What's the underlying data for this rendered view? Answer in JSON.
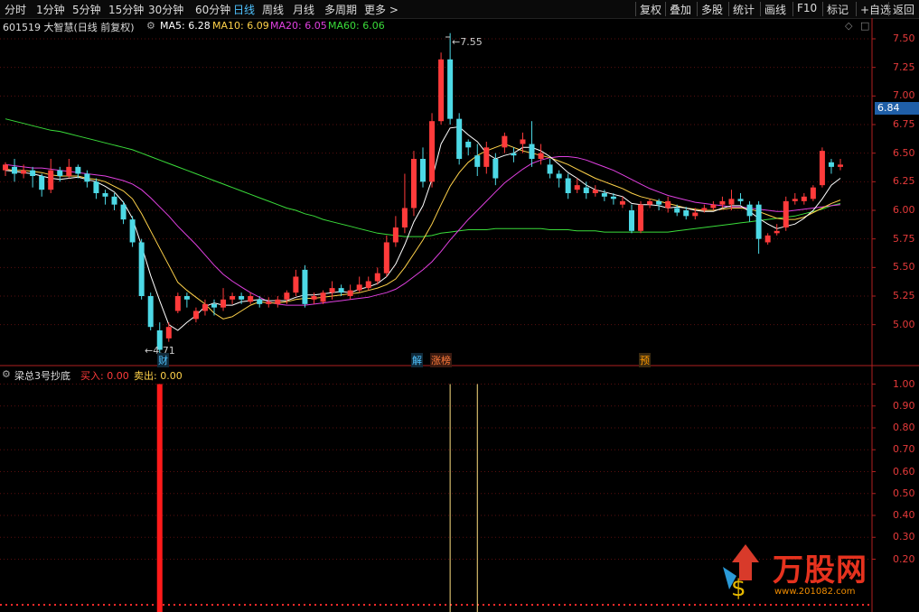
{
  "toolbar": {
    "periods": [
      "分时",
      "1分钟",
      "5分钟",
      "15分钟",
      "30分钟",
      "60分钟",
      "日线",
      "周线",
      "月线",
      "多周期",
      "更多 >"
    ],
    "active_period": "日线",
    "right_buttons": [
      "复权",
      "叠加",
      "多股",
      "统计",
      "画线",
      "F10",
      "标记",
      "+自选",
      "返回"
    ]
  },
  "stock": {
    "code_name": "601519 大智慧(日线 前复权)"
  },
  "ma": [
    {
      "label": "MA5: 6.28",
      "color": "#ffffff"
    },
    {
      "label": "MA10: 6.09",
      "color": "#ffd24a"
    },
    {
      "label": "MA20: 6.05",
      "color": "#e040e0"
    },
    {
      "label": "MA60: 6.06",
      "color": "#3adc3a"
    }
  ],
  "colors": {
    "up": "#ff3b3b",
    "down": "#4dd9e6",
    "axis": "#b02020",
    "grid": "#5a0f0f"
  },
  "price_axis": {
    "ticks": [
      "7.50",
      "7.25",
      "7.00",
      "6.75",
      "6.50",
      "6.25",
      "6.00",
      "5.75",
      "5.50",
      "5.25",
      "5.00"
    ],
    "current": "6.84"
  },
  "annotations": {
    "high": "7.55",
    "low": "4.71"
  },
  "events": [
    {
      "text": "财",
      "color": "#4fc3ff"
    },
    {
      "text": "解",
      "color": "#4fc3ff"
    },
    {
      "text": "涨榜",
      "color": "#ff7a3a"
    },
    {
      "text": "预",
      "color": "#ff9a00"
    }
  ],
  "indicator": {
    "name": "梁总3号抄底",
    "buy_label": "买入: 0.00",
    "sell_label": "卖出: 0.00",
    "axis_ticks": [
      "1.00",
      "0.90",
      "0.80",
      "0.70",
      "0.60",
      "0.50",
      "0.40",
      "0.30",
      "0.20"
    ]
  },
  "watermark": {
    "text": "万股网",
    "url": "www.201082.com"
  },
  "chart_data": {
    "type": "candlestick",
    "ylim": [
      4.65,
      7.65
    ],
    "candles": [
      [
        6.35,
        6.4,
        6.3,
        6.42
      ],
      [
        6.38,
        6.32,
        6.25,
        6.45
      ],
      [
        6.32,
        6.35,
        6.28,
        6.4
      ],
      [
        6.35,
        6.3,
        6.2,
        6.38
      ],
      [
        6.3,
        6.18,
        6.12,
        6.32
      ],
      [
        6.18,
        6.35,
        6.15,
        6.45
      ],
      [
        6.35,
        6.3,
        6.25,
        6.38
      ],
      [
        6.3,
        6.38,
        6.28,
        6.45
      ],
      [
        6.38,
        6.32,
        6.28,
        6.4
      ],
      [
        6.32,
        6.25,
        6.2,
        6.35
      ],
      [
        6.25,
        6.15,
        6.1,
        6.28
      ],
      [
        6.15,
        6.12,
        6.05,
        6.18
      ],
      [
        6.12,
        6.05,
        6.0,
        6.15
      ],
      [
        6.05,
        5.92,
        5.88,
        6.08
      ],
      [
        5.92,
        5.72,
        5.68,
        5.95
      ],
      [
        5.72,
        5.25,
        5.22,
        5.75
      ],
      [
        5.25,
        4.98,
        4.95,
        5.28
      ],
      [
        4.95,
        4.78,
        4.71,
        5.02
      ],
      [
        4.88,
        4.98,
        4.85,
        5.02
      ],
      [
        5.12,
        5.25,
        5.1,
        5.28
      ],
      [
        5.25,
        5.22,
        5.15,
        5.28
      ],
      [
        5.05,
        5.12,
        5.02,
        5.15
      ],
      [
        5.12,
        5.18,
        5.08,
        5.22
      ],
      [
        5.18,
        5.15,
        5.08,
        5.22
      ],
      [
        5.15,
        5.22,
        5.12,
        5.32
      ],
      [
        5.22,
        5.25,
        5.18,
        5.28
      ],
      [
        5.25,
        5.22,
        5.18,
        5.28
      ],
      [
        5.2,
        5.25,
        5.18,
        5.28
      ],
      [
        5.22,
        5.18,
        5.15,
        5.25
      ],
      [
        5.18,
        5.2,
        5.15,
        5.24
      ],
      [
        5.18,
        5.22,
        5.15,
        5.25
      ],
      [
        5.22,
        5.28,
        5.18,
        5.3
      ],
      [
        5.28,
        5.42,
        5.25,
        5.48
      ],
      [
        5.48,
        5.18,
        5.15,
        5.52
      ],
      [
        5.22,
        5.25,
        5.18,
        5.28
      ],
      [
        5.2,
        5.28,
        5.18,
        5.3
      ],
      [
        5.28,
        5.32,
        5.22,
        5.38
      ],
      [
        5.32,
        5.28,
        5.25,
        5.35
      ],
      [
        5.25,
        5.3,
        5.22,
        5.35
      ],
      [
        5.3,
        5.35,
        5.28,
        5.42
      ],
      [
        5.32,
        5.38,
        5.3,
        5.42
      ],
      [
        5.38,
        5.45,
        5.35,
        5.5
      ],
      [
        5.45,
        5.72,
        5.42,
        5.78
      ],
      [
        5.72,
        5.85,
        5.68,
        5.95
      ],
      [
        5.85,
        6.02,
        5.8,
        6.32
      ],
      [
        6.02,
        6.45,
        5.95,
        6.52
      ],
      [
        6.45,
        6.25,
        6.2,
        6.55
      ],
      [
        6.25,
        6.78,
        6.2,
        6.85
      ],
      [
        6.78,
        7.32,
        6.75,
        7.38
      ],
      [
        7.32,
        6.8,
        6.75,
        7.55
      ],
      [
        6.8,
        6.45,
        6.4,
        6.85
      ],
      [
        6.6,
        6.55,
        6.48,
        6.62
      ],
      [
        6.48,
        6.38,
        6.3,
        6.58
      ],
      [
        6.38,
        6.55,
        6.32,
        6.6
      ],
      [
        6.45,
        6.28,
        6.22,
        6.5
      ],
      [
        6.55,
        6.65,
        6.5,
        6.68
      ],
      [
        6.5,
        6.48,
        6.42,
        6.55
      ],
      [
        6.58,
        6.62,
        6.5,
        6.68
      ],
      [
        6.58,
        6.45,
        6.38,
        6.78
      ],
      [
        6.45,
        6.5,
        6.4,
        6.58
      ],
      [
        6.4,
        6.32,
        6.28,
        6.45
      ],
      [
        6.32,
        6.28,
        6.2,
        6.35
      ],
      [
        6.28,
        6.15,
        6.1,
        6.32
      ],
      [
        6.18,
        6.22,
        6.15,
        6.28
      ],
      [
        6.2,
        6.15,
        6.1,
        6.25
      ],
      [
        6.15,
        6.18,
        6.12,
        6.22
      ],
      [
        6.15,
        6.12,
        6.08,
        6.18
      ],
      [
        6.12,
        6.1,
        6.05,
        6.15
      ],
      [
        6.05,
        6.08,
        6.02,
        6.12
      ],
      [
        6.0,
        5.82,
        5.8,
        6.05
      ],
      [
        5.82,
        6.05,
        5.8,
        6.08
      ],
      [
        6.05,
        6.08,
        6.02,
        6.1
      ],
      [
        6.08,
        6.05,
        6.0,
        6.1
      ],
      [
        6.02,
        6.08,
        5.98,
        6.12
      ],
      [
        6.02,
        5.98,
        5.95,
        6.05
      ],
      [
        6.0,
        5.95,
        5.92,
        6.03
      ],
      [
        5.95,
        5.98,
        5.92,
        6.02
      ],
      [
        6.0,
        6.02,
        5.98,
        6.05
      ],
      [
        6.02,
        6.05,
        6.0,
        6.08
      ],
      [
        6.05,
        6.08,
        6.02,
        6.12
      ],
      [
        6.05,
        6.1,
        6.0,
        6.18
      ],
      [
        6.1,
        6.08,
        6.05,
        6.15
      ],
      [
        6.05,
        5.95,
        5.9,
        6.08
      ],
      [
        6.05,
        5.75,
        5.62,
        6.08
      ],
      [
        5.72,
        5.78,
        5.7,
        5.8
      ],
      [
        5.8,
        5.82,
        5.78,
        5.88
      ],
      [
        5.85,
        6.08,
        5.82,
        6.12
      ],
      [
        6.08,
        6.1,
        6.05,
        6.15
      ],
      [
        6.08,
        6.12,
        6.05,
        6.15
      ],
      [
        6.1,
        6.2,
        6.08,
        6.22
      ],
      [
        6.22,
        6.52,
        6.2,
        6.55
      ],
      [
        6.42,
        6.38,
        6.32,
        6.45
      ],
      [
        6.38,
        6.4,
        6.35,
        6.45
      ]
    ],
    "ma5": [
      6.35,
      6.34,
      6.33,
      6.32,
      6.3,
      6.28,
      6.27,
      6.28,
      6.29,
      6.27,
      6.25,
      6.21,
      6.16,
      6.07,
      5.93,
      5.69,
      5.43,
      5.21,
      5.0,
      4.95,
      5.02,
      5.08,
      5.16,
      5.19,
      5.17,
      5.17,
      5.2,
      5.21,
      5.22,
      5.21,
      5.21,
      5.21,
      5.24,
      5.26,
      5.26,
      5.27,
      5.28,
      5.29,
      5.28,
      5.31,
      5.33,
      5.36,
      5.42,
      5.53,
      5.7,
      5.9,
      6.04,
      6.27,
      6.58,
      6.72,
      6.73,
      6.66,
      6.6,
      6.5,
      6.45,
      6.48,
      6.5,
      6.55,
      6.55,
      6.52,
      6.47,
      6.4,
      6.33,
      6.28,
      6.22,
      6.18,
      6.16,
      6.14,
      6.12,
      6.06,
      6.05,
      6.05,
      6.04,
      6.02,
      6.03,
      6.02,
      6.0,
      5.99,
      5.99,
      6.02,
      6.04,
      6.04,
      5.99,
      5.93,
      5.88,
      5.84,
      5.86,
      5.88,
      5.93,
      6.0,
      6.1,
      6.22,
      6.28
    ],
    "ma10": [
      6.36,
      6.35,
      6.35,
      6.34,
      6.33,
      6.31,
      6.3,
      6.3,
      6.3,
      6.28,
      6.27,
      6.25,
      6.21,
      6.17,
      6.1,
      5.97,
      5.82,
      5.67,
      5.52,
      5.37,
      5.3,
      5.24,
      5.18,
      5.1,
      5.05,
      5.07,
      5.12,
      5.17,
      5.2,
      5.19,
      5.19,
      5.2,
      5.22,
      5.23,
      5.23,
      5.24,
      5.25,
      5.26,
      5.27,
      5.28,
      5.3,
      5.32,
      5.35,
      5.4,
      5.5,
      5.62,
      5.74,
      5.88,
      6.05,
      6.21,
      6.33,
      6.42,
      6.48,
      6.52,
      6.55,
      6.58,
      6.55,
      6.52,
      6.5,
      6.48,
      6.46,
      6.43,
      6.4,
      6.36,
      6.32,
      6.28,
      6.25,
      6.22,
      6.19,
      6.15,
      6.12,
      6.1,
      6.08,
      6.06,
      6.04,
      6.02,
      6.01,
      6.0,
      6.0,
      6.01,
      6.02,
      6.02,
      6.01,
      5.99,
      5.96,
      5.93,
      5.92,
      5.92,
      5.94,
      5.98,
      6.02,
      6.06,
      6.09
    ],
    "ma20": [
      6.4,
      6.39,
      6.38,
      6.37,
      6.37,
      6.36,
      6.35,
      6.34,
      6.33,
      6.32,
      6.31,
      6.3,
      6.28,
      6.26,
      6.23,
      6.18,
      6.11,
      6.03,
      5.95,
      5.86,
      5.78,
      5.7,
      5.61,
      5.52,
      5.44,
      5.38,
      5.33,
      5.28,
      5.24,
      5.2,
      5.18,
      5.17,
      5.17,
      5.17,
      5.18,
      5.19,
      5.2,
      5.21,
      5.22,
      5.23,
      5.24,
      5.26,
      5.28,
      5.31,
      5.36,
      5.42,
      5.48,
      5.55,
      5.64,
      5.74,
      5.83,
      5.92,
      6.0,
      6.08,
      6.16,
      6.24,
      6.3,
      6.36,
      6.41,
      6.44,
      6.46,
      6.47,
      6.47,
      6.46,
      6.44,
      6.41,
      6.38,
      6.35,
      6.31,
      6.27,
      6.23,
      6.19,
      6.16,
      6.13,
      6.11,
      6.09,
      6.07,
      6.06,
      6.05,
      6.04,
      6.03,
      6.03,
      6.02,
      6.01,
      6.0,
      5.99,
      5.99,
      6.0,
      6.01,
      6.02,
      6.03,
      6.04,
      6.05
    ],
    "ma60": [
      6.8,
      6.78,
      6.76,
      6.74,
      6.72,
      6.7,
      6.69,
      6.67,
      6.65,
      6.63,
      6.61,
      6.59,
      6.57,
      6.55,
      6.53,
      6.5,
      6.47,
      6.44,
      6.41,
      6.38,
      6.35,
      6.32,
      6.29,
      6.26,
      6.23,
      6.2,
      6.17,
      6.14,
      6.11,
      6.08,
      6.05,
      6.02,
      6.0,
      5.97,
      5.95,
      5.92,
      5.9,
      5.88,
      5.86,
      5.84,
      5.82,
      5.8,
      5.79,
      5.78,
      5.77,
      5.77,
      5.77,
      5.78,
      5.8,
      5.81,
      5.82,
      5.83,
      5.83,
      5.83,
      5.84,
      5.84,
      5.84,
      5.84,
      5.84,
      5.84,
      5.83,
      5.83,
      5.83,
      5.82,
      5.82,
      5.82,
      5.81,
      5.81,
      5.81,
      5.81,
      5.81,
      5.81,
      5.81,
      5.81,
      5.82,
      5.83,
      5.84,
      5.85,
      5.86,
      5.87,
      5.88,
      5.89,
      5.9,
      5.91,
      5.92,
      5.93,
      5.94,
      5.95,
      5.97,
      5.99,
      6.01,
      6.04,
      6.06
    ],
    "signals": [
      {
        "index": 17,
        "value": 1.0,
        "type": "buy"
      },
      {
        "index": 49,
        "value": 1.0,
        "type": "sell"
      },
      {
        "index": 52,
        "value": 1.0,
        "type": "sell"
      }
    ]
  }
}
